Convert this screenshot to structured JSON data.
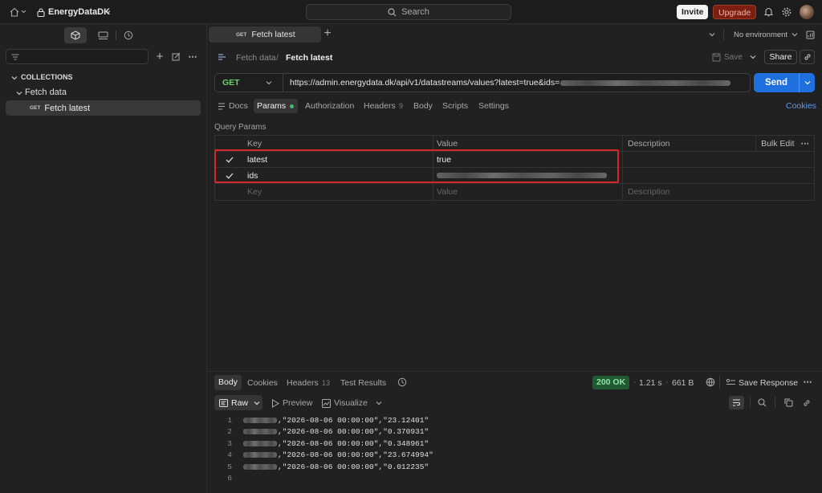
{
  "topbar": {
    "workspace": "EnergyDataDK",
    "search_placeholder": "Search",
    "invite": "Invite",
    "upgrade": "Upgrade"
  },
  "sidebar": {
    "section": "COLLECTIONS",
    "folder": "Fetch data",
    "request_method": "GET",
    "request_name": "Fetch latest"
  },
  "tab": {
    "method": "GET",
    "name": "Fetch latest"
  },
  "environment": "No environment",
  "breadcrumb": {
    "parent": "Fetch data",
    "sep": "/",
    "current": "Fetch latest"
  },
  "actions": {
    "save": "Save",
    "share": "Share"
  },
  "request": {
    "method": "GET",
    "url": "https://admin.energydata.dk/api/v1/datastreams/values?latest=true&ids=",
    "send": "Send"
  },
  "req_tabs": {
    "docs": "Docs",
    "params": "Params",
    "authorization": "Authorization",
    "headers": "Headers",
    "headers_count": "9",
    "body": "Body",
    "scripts": "Scripts",
    "settings": "Settings",
    "cookies": "Cookies"
  },
  "params": {
    "title": "Query Params",
    "col_key": "Key",
    "col_value": "Value",
    "col_desc": "Description",
    "bulk_edit": "Bulk Edit",
    "rows": [
      {
        "key": "latest",
        "value": "true"
      },
      {
        "key": "ids",
        "value": ""
      }
    ],
    "ph_key": "Key",
    "ph_value": "Value",
    "ph_desc": "Description"
  },
  "response": {
    "tabs": {
      "body": "Body",
      "cookies": "Cookies",
      "headers": "Headers",
      "headers_count": "13",
      "tests": "Test Results"
    },
    "status": "200 OK",
    "time": "1.21 s",
    "size": "661 B",
    "save_response": "Save Response",
    "view": {
      "raw": "Raw",
      "preview": "Preview",
      "visualize": "Visualize"
    },
    "lines": [
      {
        "n": "1",
        "text": ",\"2026-08-06 00:00:00\",\"23.12401\""
      },
      {
        "n": "2",
        "text": ",\"2026-08-06 00:00:00\",\"0.370931\""
      },
      {
        "n": "3",
        "text": ",\"2026-08-06 00:00:00\",\"0.348961\""
      },
      {
        "n": "4",
        "text": ",\"2026-08-06 00:00:00\",\"23.674994\""
      },
      {
        "n": "5",
        "text": ",\"2026-08-06 00:00:00\",\"0.012235\""
      },
      {
        "n": "6",
        "text": ""
      }
    ]
  },
  "colors": {
    "accent": "#1f6fde",
    "status_ok": "#1f7a3a",
    "highlight": "#d7262a"
  }
}
